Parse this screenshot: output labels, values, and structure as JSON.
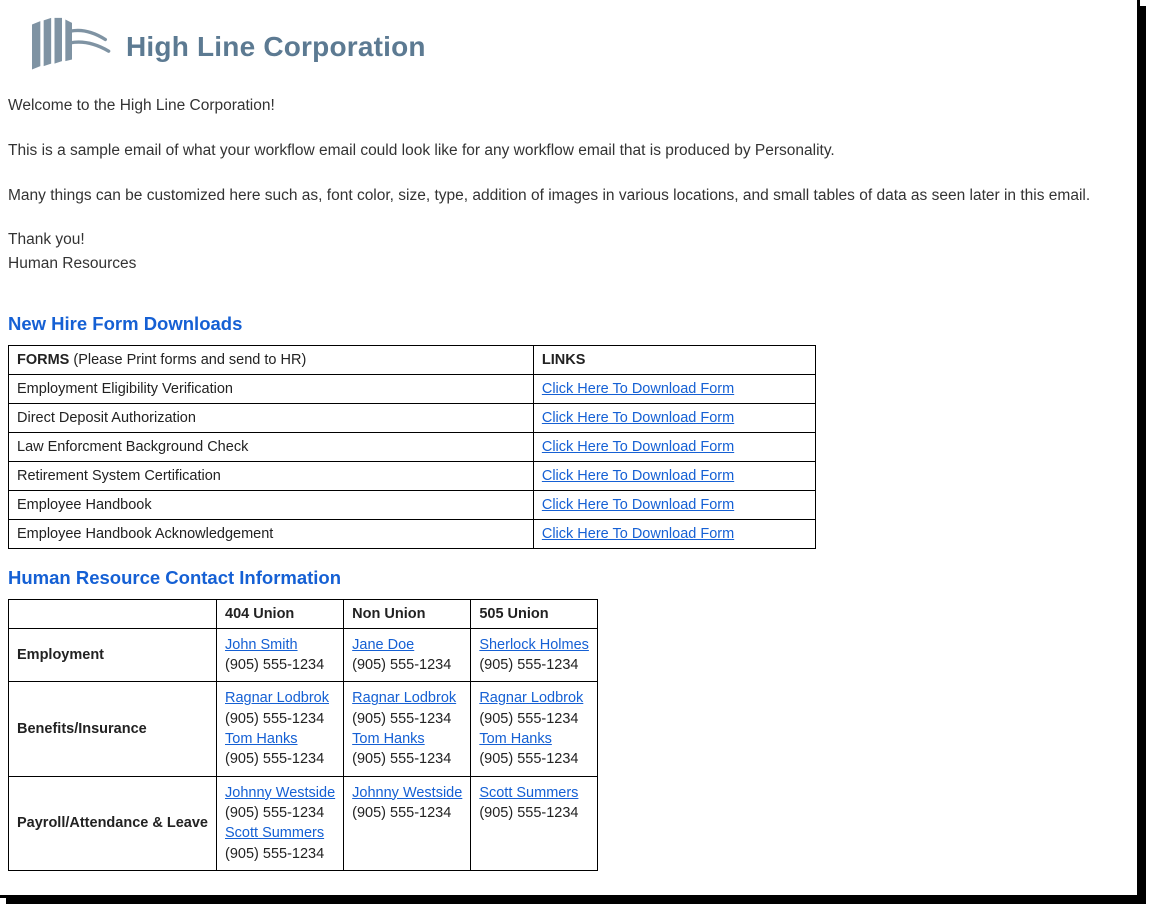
{
  "header": {
    "company_name": "High Line Corporation"
  },
  "intro": {
    "p1": "Welcome to the High Line Corporation!",
    "p2": "This is a sample email of what your workflow email could look like for any workflow email that is produced by Personality.",
    "p3": "Many things can be customized here such as, font color, size, type, addition of images in various locations, and small tables of data as seen later in this email.",
    "sig1": "Thank you!",
    "sig2": "Human Resources"
  },
  "forms_section": {
    "title": "New Hire Form Downloads",
    "col_forms_label": "FORMS",
    "col_forms_note": " (Please Print forms and send to HR)",
    "col_links_label": "LINKS",
    "link_text": "Click Here To Download Form",
    "rows": [
      "Employment Eligibility Verification",
      "Direct Deposit Authorization",
      "Law Enforcment Background Check",
      "Retirement System Certification",
      "Employee Handbook",
      "Employee Handbook Acknowledgement"
    ]
  },
  "contacts_section": {
    "title": "Human Resource Contact Information",
    "columns": [
      "404 Union",
      "Non Union",
      "505 Union"
    ],
    "rows": [
      {
        "label": "Employment",
        "cells": [
          [
            {
              "name": "John Smith",
              "phone": "(905) 555-1234"
            }
          ],
          [
            {
              "name": "Jane Doe",
              "phone": "(905) 555-1234"
            }
          ],
          [
            {
              "name": "Sherlock Holmes",
              "phone": "(905) 555-1234"
            }
          ]
        ]
      },
      {
        "label": "Benefits/Insurance",
        "cells": [
          [
            {
              "name": "Ragnar Lodbrok",
              "phone": "(905) 555-1234"
            },
            {
              "name": "Tom Hanks",
              "phone": "(905) 555-1234"
            }
          ],
          [
            {
              "name": "Ragnar Lodbrok",
              "phone": "(905) 555-1234"
            },
            {
              "name": "Tom Hanks",
              "phone": "(905) 555-1234"
            }
          ],
          [
            {
              "name": "Ragnar Lodbrok",
              "phone": "(905) 555-1234"
            },
            {
              "name": "Tom Hanks",
              "phone": "(905) 555-1234"
            }
          ]
        ]
      },
      {
        "label": "Payroll/Attendance & Leave",
        "cells": [
          [
            {
              "name": "Johnny Westside",
              "phone": "(905) 555-1234"
            },
            {
              "name": "Scott Summers",
              "phone": "(905) 555-1234"
            }
          ],
          [
            {
              "name": "Johnny Westside",
              "phone": "(905) 555-1234"
            }
          ],
          [
            {
              "name": "Scott Summers",
              "phone": "(905) 555-1234"
            }
          ]
        ]
      }
    ]
  }
}
